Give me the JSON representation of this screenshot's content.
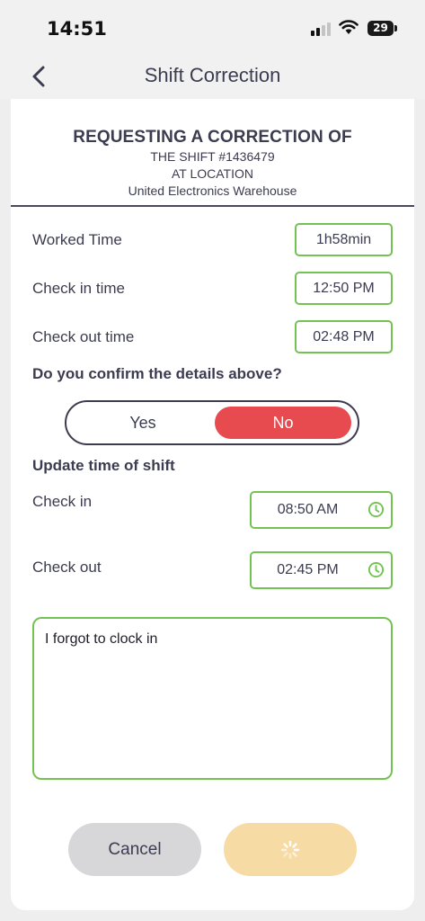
{
  "status_bar": {
    "time": "14:51",
    "battery": "29",
    "signal_icon": "cellular-signal-icon",
    "wifi_icon": "wifi-icon"
  },
  "nav": {
    "title": "Shift Correction",
    "back_icon": "chevron-left-icon"
  },
  "request": {
    "title": "REQUESTING A CORRECTION OF",
    "shift_line": "THE SHIFT #1436479",
    "location_line": "AT LOCATION",
    "location_name": "United Electronics Warehouse"
  },
  "details": {
    "worked_time_label": "Worked Time",
    "worked_time_value": "1h58min",
    "check_in_label": "Check in time",
    "check_in_value": "12:50 PM",
    "check_out_label": "Check out time",
    "check_out_value": "02:48 PM"
  },
  "confirm": {
    "question": "Do you confirm the details above?",
    "yes_label": "Yes",
    "no_label": "No",
    "selected": "No"
  },
  "update": {
    "title": "Update time of shift",
    "check_in_label": "Check in",
    "check_in_value": "08:50 AM",
    "check_out_label": "Check out",
    "check_out_value": "02:45 PM",
    "clock_icon": "clock-icon"
  },
  "comment": {
    "text": "I forgot to clock in"
  },
  "actions": {
    "cancel_label": "Cancel",
    "submit_state_icon": "loading-spinner-icon"
  },
  "colors": {
    "accent_green": "#73c351",
    "danger_red": "#e74a4f",
    "submit_disabled": "#f7dba4",
    "text_dark": "#3c3c50"
  }
}
